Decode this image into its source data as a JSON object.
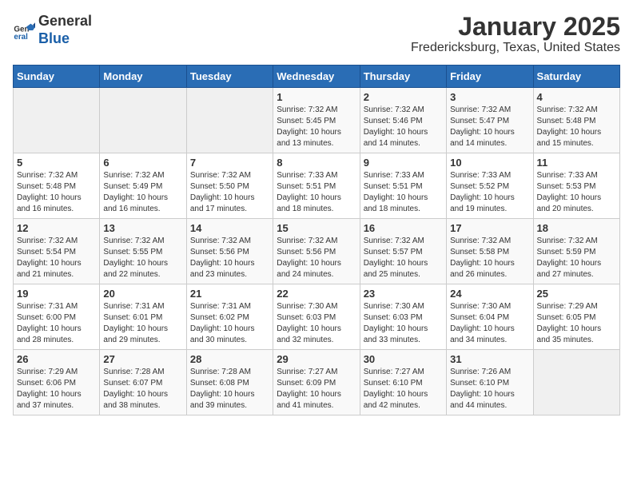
{
  "logo": {
    "line1": "General",
    "line2": "Blue"
  },
  "title": "January 2025",
  "subtitle": "Fredericksburg, Texas, United States",
  "weekdays": [
    "Sunday",
    "Monday",
    "Tuesday",
    "Wednesday",
    "Thursday",
    "Friday",
    "Saturday"
  ],
  "weeks": [
    [
      {
        "day": "",
        "info": ""
      },
      {
        "day": "",
        "info": ""
      },
      {
        "day": "",
        "info": ""
      },
      {
        "day": "1",
        "info": "Sunrise: 7:32 AM\nSunset: 5:45 PM\nDaylight: 10 hours and 13 minutes."
      },
      {
        "day": "2",
        "info": "Sunrise: 7:32 AM\nSunset: 5:46 PM\nDaylight: 10 hours and 14 minutes."
      },
      {
        "day": "3",
        "info": "Sunrise: 7:32 AM\nSunset: 5:47 PM\nDaylight: 10 hours and 14 minutes."
      },
      {
        "day": "4",
        "info": "Sunrise: 7:32 AM\nSunset: 5:48 PM\nDaylight: 10 hours and 15 minutes."
      }
    ],
    [
      {
        "day": "5",
        "info": "Sunrise: 7:32 AM\nSunset: 5:48 PM\nDaylight: 10 hours and 16 minutes."
      },
      {
        "day": "6",
        "info": "Sunrise: 7:32 AM\nSunset: 5:49 PM\nDaylight: 10 hours and 16 minutes."
      },
      {
        "day": "7",
        "info": "Sunrise: 7:32 AM\nSunset: 5:50 PM\nDaylight: 10 hours and 17 minutes."
      },
      {
        "day": "8",
        "info": "Sunrise: 7:33 AM\nSunset: 5:51 PM\nDaylight: 10 hours and 18 minutes."
      },
      {
        "day": "9",
        "info": "Sunrise: 7:33 AM\nSunset: 5:51 PM\nDaylight: 10 hours and 18 minutes."
      },
      {
        "day": "10",
        "info": "Sunrise: 7:33 AM\nSunset: 5:52 PM\nDaylight: 10 hours and 19 minutes."
      },
      {
        "day": "11",
        "info": "Sunrise: 7:33 AM\nSunset: 5:53 PM\nDaylight: 10 hours and 20 minutes."
      }
    ],
    [
      {
        "day": "12",
        "info": "Sunrise: 7:32 AM\nSunset: 5:54 PM\nDaylight: 10 hours and 21 minutes."
      },
      {
        "day": "13",
        "info": "Sunrise: 7:32 AM\nSunset: 5:55 PM\nDaylight: 10 hours and 22 minutes."
      },
      {
        "day": "14",
        "info": "Sunrise: 7:32 AM\nSunset: 5:56 PM\nDaylight: 10 hours and 23 minutes."
      },
      {
        "day": "15",
        "info": "Sunrise: 7:32 AM\nSunset: 5:56 PM\nDaylight: 10 hours and 24 minutes."
      },
      {
        "day": "16",
        "info": "Sunrise: 7:32 AM\nSunset: 5:57 PM\nDaylight: 10 hours and 25 minutes."
      },
      {
        "day": "17",
        "info": "Sunrise: 7:32 AM\nSunset: 5:58 PM\nDaylight: 10 hours and 26 minutes."
      },
      {
        "day": "18",
        "info": "Sunrise: 7:32 AM\nSunset: 5:59 PM\nDaylight: 10 hours and 27 minutes."
      }
    ],
    [
      {
        "day": "19",
        "info": "Sunrise: 7:31 AM\nSunset: 6:00 PM\nDaylight: 10 hours and 28 minutes."
      },
      {
        "day": "20",
        "info": "Sunrise: 7:31 AM\nSunset: 6:01 PM\nDaylight: 10 hours and 29 minutes."
      },
      {
        "day": "21",
        "info": "Sunrise: 7:31 AM\nSunset: 6:02 PM\nDaylight: 10 hours and 30 minutes."
      },
      {
        "day": "22",
        "info": "Sunrise: 7:30 AM\nSunset: 6:03 PM\nDaylight: 10 hours and 32 minutes."
      },
      {
        "day": "23",
        "info": "Sunrise: 7:30 AM\nSunset: 6:03 PM\nDaylight: 10 hours and 33 minutes."
      },
      {
        "day": "24",
        "info": "Sunrise: 7:30 AM\nSunset: 6:04 PM\nDaylight: 10 hours and 34 minutes."
      },
      {
        "day": "25",
        "info": "Sunrise: 7:29 AM\nSunset: 6:05 PM\nDaylight: 10 hours and 35 minutes."
      }
    ],
    [
      {
        "day": "26",
        "info": "Sunrise: 7:29 AM\nSunset: 6:06 PM\nDaylight: 10 hours and 37 minutes."
      },
      {
        "day": "27",
        "info": "Sunrise: 7:28 AM\nSunset: 6:07 PM\nDaylight: 10 hours and 38 minutes."
      },
      {
        "day": "28",
        "info": "Sunrise: 7:28 AM\nSunset: 6:08 PM\nDaylight: 10 hours and 39 minutes."
      },
      {
        "day": "29",
        "info": "Sunrise: 7:27 AM\nSunset: 6:09 PM\nDaylight: 10 hours and 41 minutes."
      },
      {
        "day": "30",
        "info": "Sunrise: 7:27 AM\nSunset: 6:10 PM\nDaylight: 10 hours and 42 minutes."
      },
      {
        "day": "31",
        "info": "Sunrise: 7:26 AM\nSunset: 6:10 PM\nDaylight: 10 hours and 44 minutes."
      },
      {
        "day": "",
        "info": ""
      }
    ]
  ]
}
